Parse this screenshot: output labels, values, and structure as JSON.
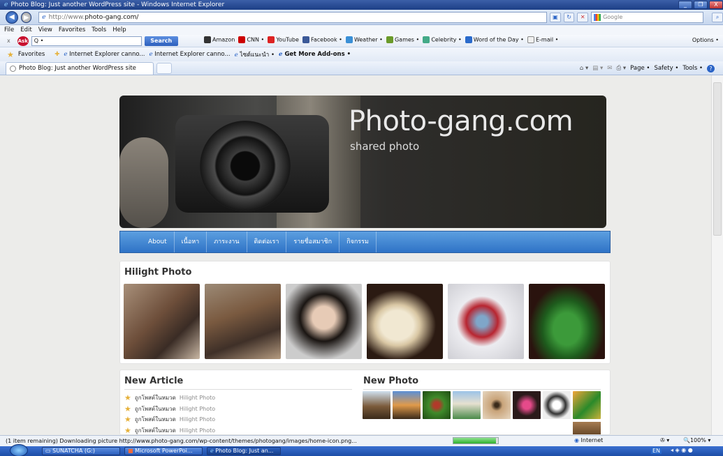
{
  "window": {
    "title": "Photo Blog: Just another WordPress site - Windows Internet Explorer",
    "min": "_",
    "max": "❐",
    "close": "X"
  },
  "address": {
    "url_prefix": "http://www.",
    "url_domain": "photo-gang.com/",
    "search_placeholder": "Google"
  },
  "menu": [
    "File",
    "Edit",
    "View",
    "Favorites",
    "Tools",
    "Help"
  ],
  "askbar": {
    "search_value": "Q •",
    "search_btn": "Search",
    "links": [
      "Amazon",
      "CNN •",
      "YouTube",
      "Facebook •",
      "Weather •",
      "Games •",
      "Celebrity •",
      "Word of the Day •",
      "E-mail •"
    ],
    "options": "Options •"
  },
  "favorites": {
    "label": "Favorites",
    "items": [
      "Internet Explorer canno...",
      "Internet Explorer canno...",
      "ไซต์แนะนำ •",
      "Get More Add-ons •"
    ]
  },
  "tab": {
    "title": "Photo Blog: Just another WordPress site"
  },
  "commands": [
    "Page •",
    "Safety •",
    "Tools •"
  ],
  "site": {
    "title": "Photo-gang.com",
    "subtitle": "shared photo",
    "nav": [
      "About",
      "เนื้อหา",
      "ภาระงาน",
      "ติดต่อเรา",
      "รายชื่อสมาชิก",
      "กิจกรรม"
    ],
    "hilight_title": "Hilight Photo",
    "new_article_title": "New Article",
    "new_photo_title": "New Photo",
    "articles": [
      {
        "text": "ถูกโพสต์ในหมวด",
        "cat": "Hilight Photo"
      },
      {
        "text": "ถูกโพสต์ในหมวด",
        "cat": "Hilight Photo"
      },
      {
        "text": "ถูกโพสต์ในหมวด",
        "cat": "Hilight Photo"
      },
      {
        "text": "ถูกโพสต์ในหมวด",
        "cat": "Hilight Photo"
      }
    ]
  },
  "status": {
    "text": "(1 item remaining) Downloading picture http://www.photo-gang.com/wp-content/themes/photogang/images/home-icon.png...",
    "zone": "Internet",
    "zoom": "100%",
    "progress": 0.95
  },
  "taskbar": {
    "items": [
      "SUNATCHA (G:)",
      "Microsoft PowerPoi...",
      "Photo Blog: Just an..."
    ],
    "lang": "EN"
  }
}
